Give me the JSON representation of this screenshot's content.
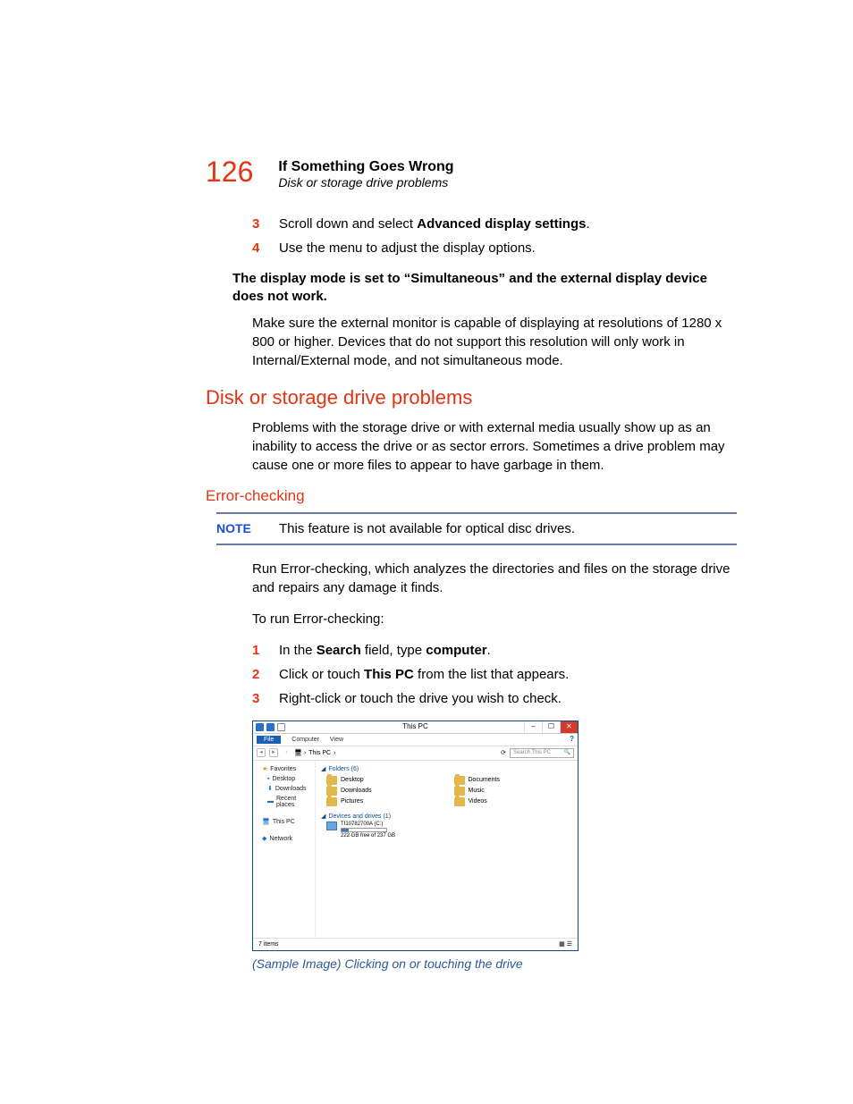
{
  "page_number": "126",
  "chapter_title": "If Something Goes Wrong",
  "section_subtitle": "Disk or storage drive problems",
  "steps_a": [
    {
      "num": "3",
      "pre": "Scroll down and select ",
      "bold": "Advanced display settings",
      "post": "."
    },
    {
      "num": "4",
      "pre": "Use the menu to adjust the display options.",
      "bold": "",
      "post": ""
    }
  ],
  "subheading1": "The display mode is set to “Simultaneous” and the external display device does not work.",
  "para1": "Make sure the external monitor is capable of displaying at resolutions of 1280 x 800 or higher. Devices that do not support this resolution will only work in Internal/External mode, and not simultaneous mode.",
  "h1": "Disk or storage drive problems",
  "para2": "Problems with the storage drive or with external media usually show up as an inability to access the drive or as sector errors. Sometimes a drive problem may cause one or more files to appear to have garbage in them.",
  "h2": "Error-checking",
  "note_label": "NOTE",
  "note_text": "This feature is not available for optical disc drives.",
  "para3": "Run Error-checking, which analyzes the directories and files on the storage drive and repairs any damage it finds.",
  "para4": "To run Error-checking:",
  "steps_b": [
    {
      "num": "1",
      "pre": "In the ",
      "bold": "Search",
      "mid": " field, type ",
      "bold2": "computer",
      "post": "."
    },
    {
      "num": "2",
      "pre": "Click or touch ",
      "bold": "This PC",
      "mid": " from the list that appears.",
      "bold2": "",
      "post": ""
    },
    {
      "num": "3",
      "pre": "Right-click or touch the drive you wish to check.",
      "bold": "",
      "mid": "",
      "bold2": "",
      "post": ""
    }
  ],
  "fe": {
    "window_title": "This PC",
    "menu": {
      "file": "File",
      "computer": "Computer",
      "view": "View"
    },
    "breadcrumb": "This PC",
    "search_placeholder": "Search This PC",
    "sidebar": {
      "favorites": "Favorites",
      "desktop": "Desktop",
      "downloads": "Downloads",
      "recent": "Recent places",
      "thispc": "This PC",
      "network": "Network"
    },
    "group_folders": "Folders (6)",
    "folders": [
      "Desktop",
      "Documents",
      "Downloads",
      "Music",
      "Pictures",
      "Videos"
    ],
    "group_devices": "Devices and drives (1)",
    "drive_name": "TI10782700A (C:)",
    "drive_free": "222 GB free of 237 GB",
    "status": "7 items"
  },
  "caption": "(Sample Image) Clicking on or touching the drive"
}
